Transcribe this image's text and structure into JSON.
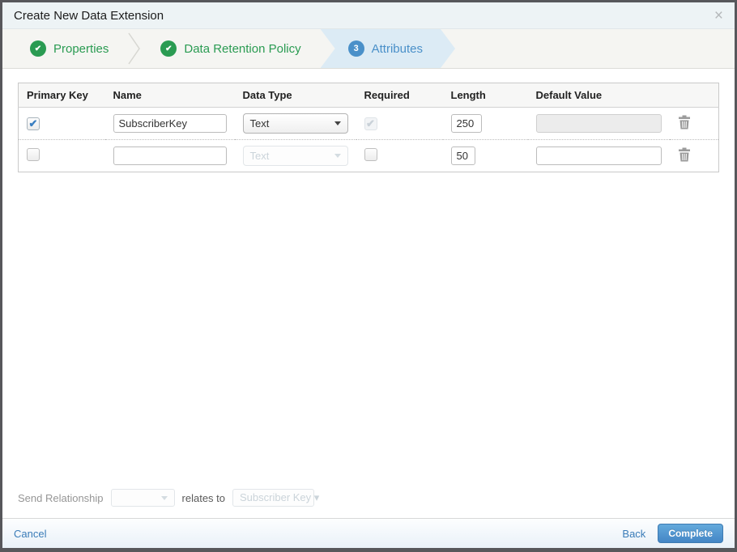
{
  "modal": {
    "title": "Create New Data Extension",
    "close_icon": "×"
  },
  "steps": {
    "check_glyph": "✔",
    "items": [
      {
        "label": "Properties",
        "state": "complete"
      },
      {
        "label": "Data Retention Policy",
        "state": "complete"
      },
      {
        "label": "Attributes",
        "state": "active",
        "number": "3"
      }
    ]
  },
  "table": {
    "headers": {
      "primary_key": "Primary Key",
      "name": "Name",
      "data_type": "Data Type",
      "required": "Required",
      "length": "Length",
      "default_value": "Default Value"
    },
    "rows": [
      {
        "primary_key_check": "✔",
        "name": "SubscriberKey",
        "data_type": "Text",
        "required_check": "✔",
        "length": "250",
        "default_value": ""
      },
      {
        "primary_key_check": "",
        "name": "",
        "data_type": "Text",
        "required_check": "",
        "length": "50",
        "default_value": ""
      }
    ]
  },
  "send_relationship": {
    "label": "Send Relationship",
    "relates_to": "relates to",
    "field_value": "Subscriber Key ▾"
  },
  "footer": {
    "cancel": "Cancel",
    "back": "Back",
    "complete": "Complete"
  },
  "colors": {
    "accent_green": "#2a9b52",
    "accent_blue": "#4a90c9",
    "active_step_bg": "#dcebf5",
    "link_blue": "#3a7cb8",
    "frame_border": "#57575b"
  }
}
